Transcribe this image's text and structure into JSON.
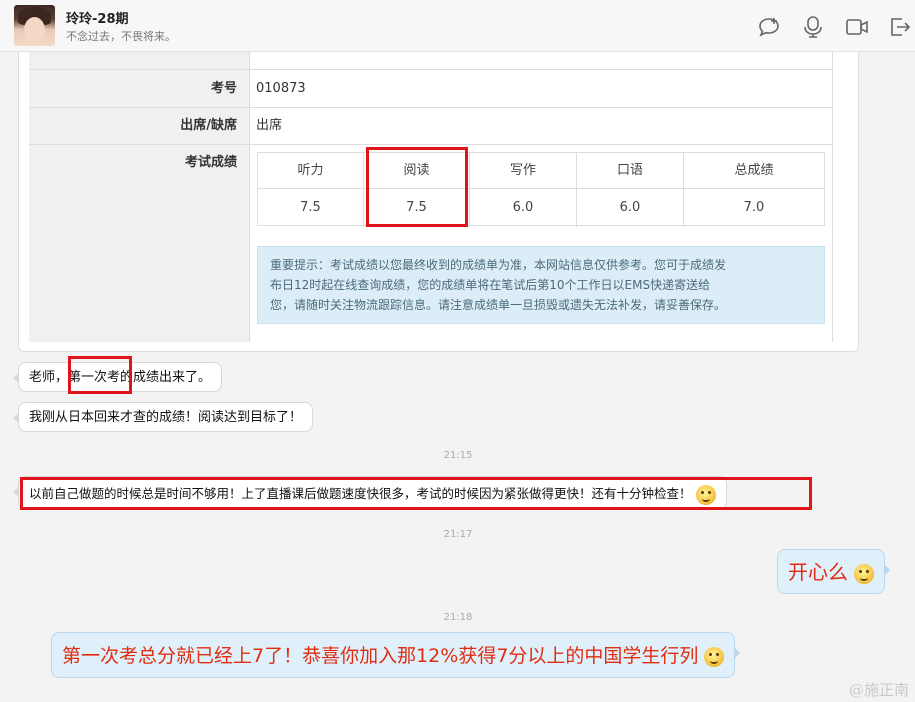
{
  "contact": {
    "name": "玲玲-28期",
    "signature": "不念过去，不畏将来。"
  },
  "header_icons": [
    "chat-bubble-icon",
    "phone-icon",
    "video-icon",
    "share-exit-icon"
  ],
  "score_report": {
    "rows": [
      {
        "label": "考号",
        "value": "010873"
      },
      {
        "label": "出席/缺席",
        "value": "出席"
      },
      {
        "label": "考试成绩",
        "value": ""
      }
    ],
    "scores": [
      {
        "label": "听力",
        "value": "7.5"
      },
      {
        "label": "阅读",
        "value": "7.5"
      },
      {
        "label": "写作",
        "value": "6.0"
      },
      {
        "label": "口语",
        "value": "6.0"
      },
      {
        "label": "总成绩",
        "value": "7.0"
      }
    ],
    "notice_lines": [
      "重要提示：考试成绩以您最终收到的成绩单为准，本网站信息仅供参考。您可于成绩发",
      "布日12时起在线查询成绩，您的成绩单将在笔试后第10个工作日以EMS快递寄送给",
      "您，请随时关注物流跟踪信息。请注意成绩单一旦损毁或遗失无法补发，请妥善保存。"
    ]
  },
  "messages": [
    {
      "side": "left",
      "text": "老师，第一次考的成绩出来了。"
    },
    {
      "side": "left",
      "text": "我刚从日本回来才查的成绩！阅读达到目标了！"
    },
    {
      "type": "time",
      "text": "21:15"
    },
    {
      "side": "left",
      "text": "以前自己做题的时候总是时间不够用！上了直播课后做题速度快很多，考试的时候因为紧张做得更快！还有十分钟检查！"
    },
    {
      "type": "time",
      "text": "21:17"
    },
    {
      "side": "right",
      "text": "开心么"
    },
    {
      "type": "time",
      "text": "21:18"
    },
    {
      "side": "right",
      "text": "第一次考总分就已经上7了！恭喜你加入那12%获得7分以上的中国学生行列"
    }
  ],
  "watermark": "@施正南"
}
